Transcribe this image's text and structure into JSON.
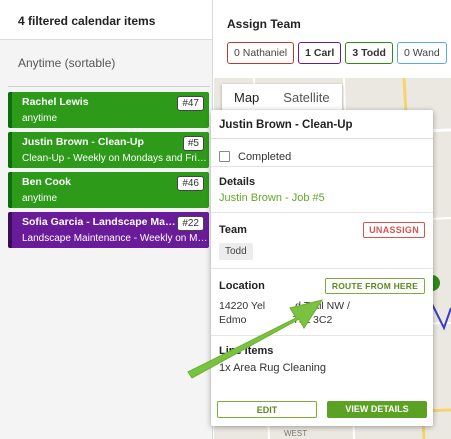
{
  "left": {
    "header": "4 filtered calendar items",
    "section": "Anytime (sortable)",
    "items": [
      {
        "title": "Rachel Lewis",
        "num": "#47",
        "sub": "anytime",
        "color": "green"
      },
      {
        "title": "Justin Brown - Clean-Up",
        "num": "#5",
        "sub": "Clean-Up - Weekly on Mondays and Fridays",
        "color": "green"
      },
      {
        "title": "Ben Cook",
        "num": "#46",
        "sub": "anytime",
        "color": "green"
      },
      {
        "title": "Sofia Garcia - Landscape Main…",
        "num": "#22",
        "sub": "Landscape Maintenance - Weekly on Mon…",
        "color": "purple"
      }
    ]
  },
  "right": {
    "title": "Assign Team",
    "chips": [
      {
        "label": "0 Nathaniel",
        "color": "#c0392b"
      },
      {
        "label": "1 Carl",
        "color": "#6a1b9a"
      },
      {
        "label": "3 Todd",
        "color": "#2e8b1a"
      },
      {
        "label": "0 Wand",
        "color": "#5aa9e6"
      }
    ],
    "map_tabs": [
      "Map",
      "Satellite"
    ],
    "map_labels": [
      "WEST"
    ]
  },
  "popup": {
    "title": "Justin Brown - Clean-Up",
    "completed_label": "Completed",
    "details_label": "Details",
    "details_link": "Justin Brown - Job #5",
    "team_label": "Team",
    "unassign": "UNASSIGN",
    "team_member": "Todd",
    "location_label": "Location",
    "route": "ROUTE FROM HERE",
    "address_line1": "14220 Yel",
    "address_line1b": "d Trail NW /",
    "address_line2": "Edmo",
    "address_line2b": "T5L 3C2",
    "line_items_label": "Line items",
    "line_item": "1x  Area Rug Cleaning",
    "edit": "EDIT",
    "view": "VIEW DETAILS"
  },
  "colors": {
    "green": "#2e9a1a",
    "purple": "#6a1b9a",
    "accent": "#5aa124",
    "danger": "#d9534f"
  }
}
